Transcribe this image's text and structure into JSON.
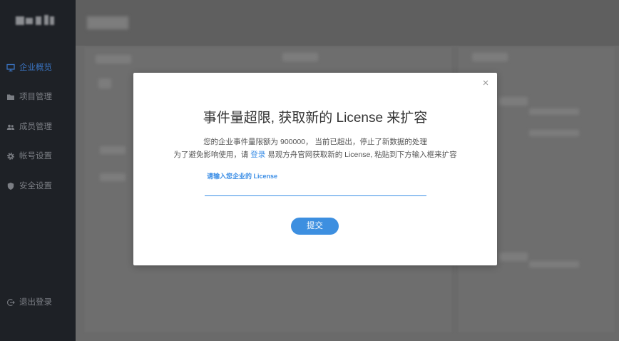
{
  "sidebar": {
    "items": [
      {
        "label": "企业概览",
        "icon": "dashboard-icon",
        "active": true
      },
      {
        "label": "项目管理",
        "icon": "folder-icon",
        "active": false
      },
      {
        "label": "成员管理",
        "icon": "users-icon",
        "active": false
      },
      {
        "label": "帐号设置",
        "icon": "gear-icon",
        "active": false
      },
      {
        "label": "安全设置",
        "icon": "shield-icon",
        "active": false
      }
    ],
    "logout": {
      "label": "退出登录",
      "icon": "logout-icon"
    }
  },
  "modal": {
    "close_glyph": "×",
    "title": "事件量超限, 获取新的 License 来扩容",
    "line1": "您的企业事件量限额为 900000， 当前已超出，停止了新数据的处理",
    "line2_prefix": "为了避免影响使用，请 ",
    "line2_link": "登录",
    "line2_suffix": " 易观方舟官网获取新的 License, 粘贴到下方输入框来扩容",
    "input_label": "请输入您企业的 License",
    "submit_label": "提交"
  },
  "colors": {
    "sidebar_bg": "#1e2126",
    "active_nav": "#3a74c2",
    "accent": "#3b8ee6",
    "overlay_gray": "#6a6a6a"
  }
}
